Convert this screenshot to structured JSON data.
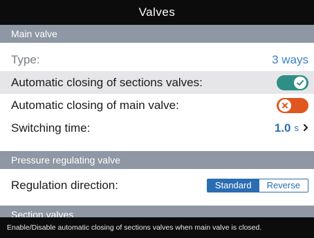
{
  "window": {
    "title": "Valves"
  },
  "main_valve": {
    "header": "Main valve",
    "type_label": "Type:",
    "type_value": "3 ways",
    "auto_close_sections_label": "Automatic closing of sections valves:",
    "auto_close_sections_state": "on",
    "auto_close_main_label": "Automatic closing of main valve:",
    "auto_close_main_state": "off",
    "switching_time_label": "Switching time:",
    "switching_time_value": "1.0",
    "switching_time_unit": "s",
    "chevron_icon": "chevron-right-icon"
  },
  "pressure_valve": {
    "header": "Pressure regulating valve",
    "direction_label": "Regulation direction:",
    "options": [
      "Standard",
      "Reverse"
    ],
    "selected": "Standard"
  },
  "section_valves": {
    "header": "Section valves"
  },
  "footer": {
    "hint": "Enable/Disable automatic closing of sections valves when main valve is closed."
  },
  "colors": {
    "title_bar": "#0c0c0c",
    "section_header": "#8e97a3",
    "toggle_on": "#2f8f86",
    "toggle_off": "#e0561f",
    "accent": "#2a6db2"
  }
}
